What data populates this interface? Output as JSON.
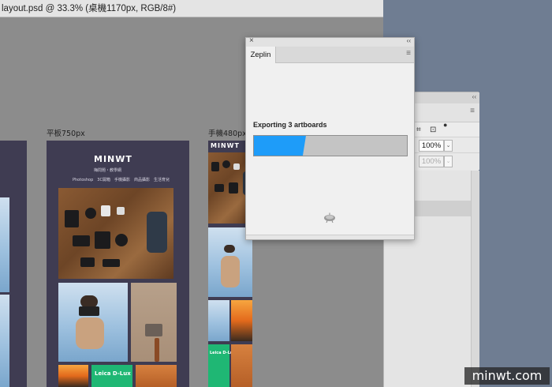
{
  "document": {
    "title": "layout.psd @ 33.3% (桌機1170px, RGB/8#)",
    "artboards": [
      {
        "name": "平板750px"
      },
      {
        "name": "手機480px"
      }
    ],
    "logo": "MINWT",
    "tagline": "梅問題・教學網",
    "nav": "Photoshop　3C開箱　手機攝影　商品攝影　生活育兒",
    "product_title": "Leica D-Lux"
  },
  "zeplin": {
    "tab_label": "Zeplin",
    "status_text": "Exporting 3 artboards",
    "progress": 0.34,
    "close_glyph": "×",
    "collapse_glyph": "‹‹",
    "menu_glyph": "≡"
  },
  "side_panel": {
    "collapse_glyph": "‹‹",
    "menu_glyph": "≡",
    "opacity_value": "100%",
    "fill_value": "100%",
    "caret_glyph": "⌄"
  },
  "watermark": "minwt.com",
  "colors": {
    "progress_fill": "#1e9cf9",
    "artboard_bg": "#3f3c52",
    "workspace_bg": "#6f7d92"
  }
}
